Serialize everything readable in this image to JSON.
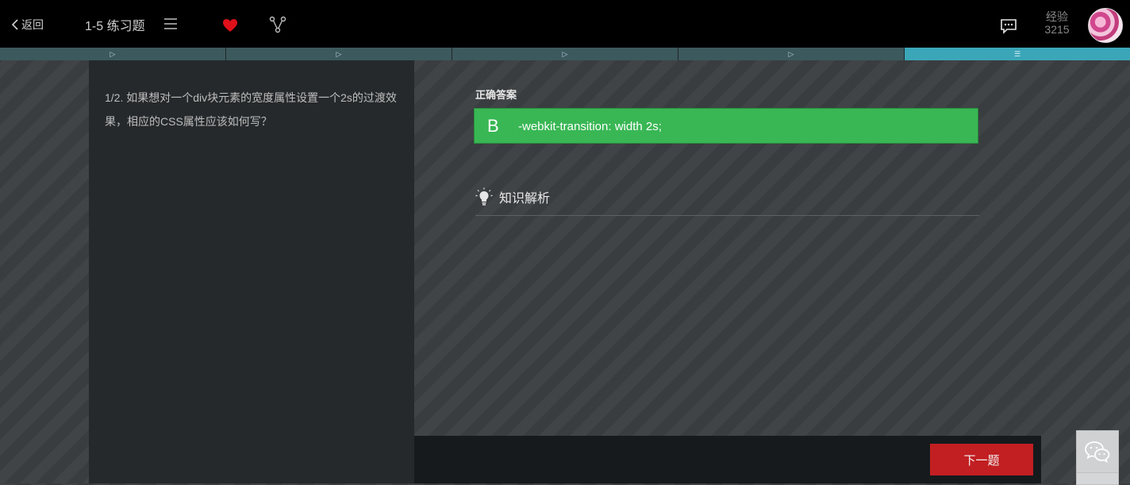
{
  "header": {
    "back_label": "返回",
    "title": "1-5 练习题",
    "exp_label": "经验",
    "exp_value": "3215",
    "icons": [
      "chevron-left-icon",
      "menu-icon",
      "heart-icon",
      "share-icon",
      "chat-icon",
      "avatar"
    ]
  },
  "steps": [
    {
      "symbol": "▷",
      "active": false
    },
    {
      "symbol": "▷",
      "active": false
    },
    {
      "symbol": "▷",
      "active": false
    },
    {
      "symbol": "▷",
      "active": false
    },
    {
      "symbol": "☰",
      "active": true
    }
  ],
  "question": {
    "text": "1/2. 如果想对一个div块元素的宽度属性设置一个2s的过渡效果，相应的CSS属性应该如何写？"
  },
  "answer": {
    "label": "正确答案",
    "letter": "B",
    "text": "-webkit-transition: width 2s;"
  },
  "analysis": {
    "title": "知识解析"
  },
  "footer": {
    "next_label": "下一题"
  },
  "colors": {
    "correct": "#39b754",
    "next_button": "#c21f23",
    "active_step": "#3aa6b7",
    "heart": "#e0101a"
  }
}
